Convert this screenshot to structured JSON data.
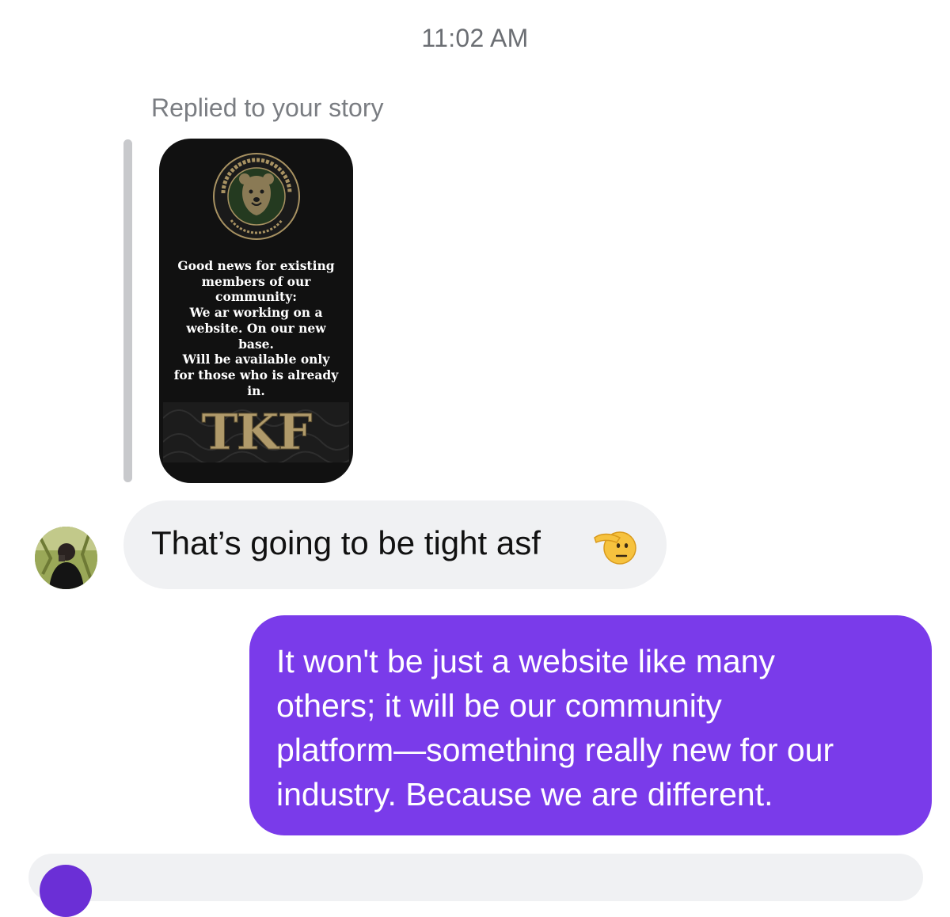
{
  "thread": {
    "timestamp": "11:02 AM",
    "story_reply": {
      "label": "Replied to your story",
      "story": {
        "logo_lettering": "THE BRAVE FARMER",
        "logo_since": "SINCE 2011",
        "text": "Good news for existing\nmembers of our\ncommunity:\nWe ar working on a\nwebsite. On our new\nbase.\nWill be available only\nfor those who is already\nin.",
        "footer_mark": "TKF"
      }
    },
    "messages": [
      {
        "direction": "incoming",
        "text": "That’s going to be tight asf",
        "emoji": "saluting-face"
      },
      {
        "direction": "outgoing",
        "text": "It won't be just a website like many\nothers; it will be our community\nplatform—something really new for our\nindustry. Because we are different."
      }
    ]
  },
  "colors": {
    "outgoing_bubble": "#7a3bea",
    "incoming_bubble": "#f0f1f3",
    "timestamp_text": "#6b6e73",
    "reply_bar": "#c8c9cc"
  }
}
